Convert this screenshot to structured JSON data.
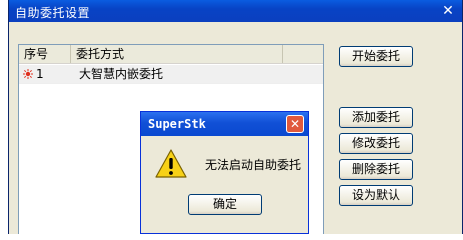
{
  "window": {
    "title": "自助委托设置",
    "close_glyph": "✕"
  },
  "table": {
    "columns": [
      "序号",
      "委托方式"
    ],
    "rows": [
      {
        "index": "1",
        "method": "大智慧内嵌委托"
      }
    ]
  },
  "buttons": {
    "start": "开始委托",
    "add": "添加委托",
    "edit": "修改委托",
    "delete": "删除委托",
    "default": "设为默认"
  },
  "dialog": {
    "title": "SuperStk",
    "message": "无法启动自助委托",
    "ok": "确定",
    "close_glyph": "✕",
    "icon": "warning-icon"
  },
  "colors": {
    "title_blue": "#0843c5",
    "close_red": "#e0593d"
  }
}
